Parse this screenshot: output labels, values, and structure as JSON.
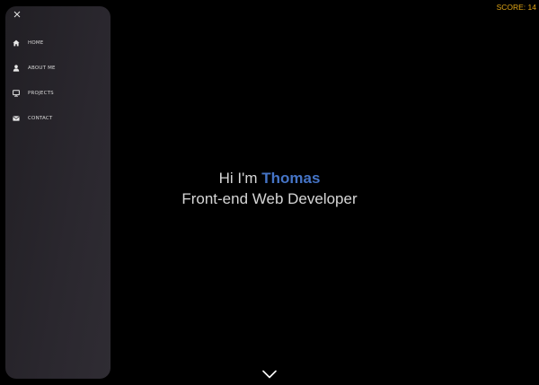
{
  "score": {
    "label": "SCORE:",
    "value": "14",
    "color": "#e0a516"
  },
  "sidebar": {
    "close_icon": "close-icon",
    "items": [
      {
        "label": "HOME",
        "icon": "home-icon"
      },
      {
        "label": "ABOUT ME",
        "icon": "user-icon"
      },
      {
        "label": "PROJECTS",
        "icon": "monitor-icon"
      },
      {
        "label": "CONTACT",
        "icon": "envelope-icon"
      }
    ]
  },
  "hero": {
    "greeting": "Hi I'm",
    "name": "Thomas",
    "title": "Front-end Web Developer",
    "accent_color": "#4574c6"
  },
  "scroll": {
    "icon": "chevron-down-icon"
  }
}
